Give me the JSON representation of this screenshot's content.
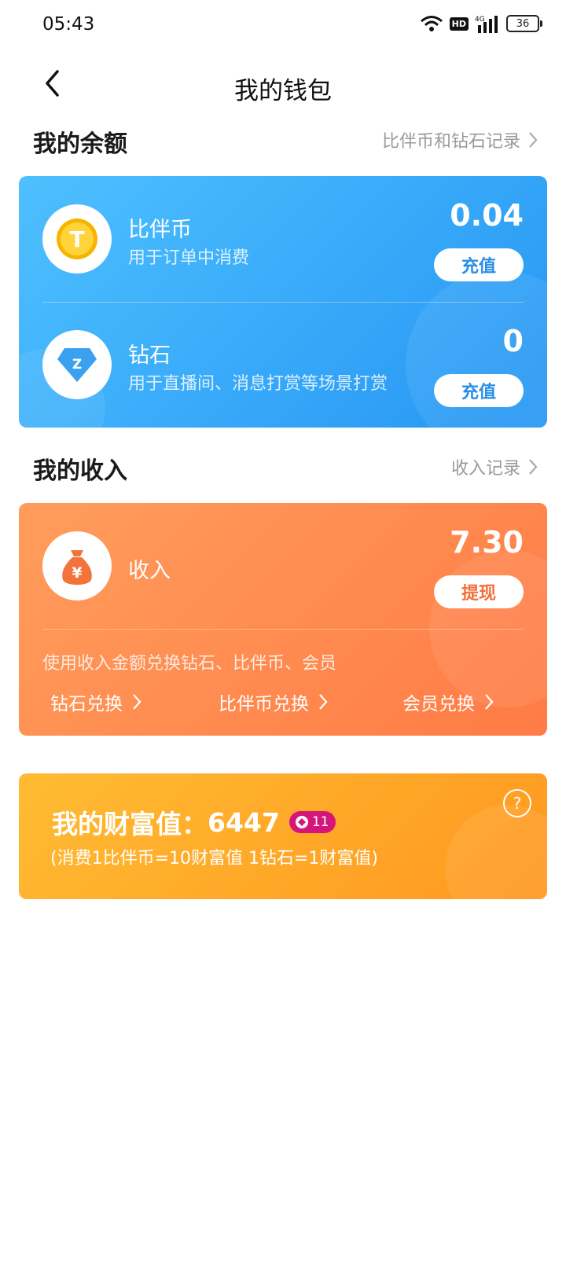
{
  "status_bar": {
    "time": "05:43",
    "hd_label": "HD",
    "signal_label": "4G",
    "battery": "36"
  },
  "nav": {
    "title": "我的钱包"
  },
  "balance_section": {
    "title": "我的余额",
    "link": "比伴币和钻石记录",
    "coin": {
      "title": "比伴币",
      "subtitle": "用于订单中消费",
      "amount": "0.04",
      "button": "充值",
      "icon_letter": "T"
    },
    "diamond": {
      "title": "钻石",
      "subtitle": "用于直播间、消息打赏等场景打赏",
      "amount": "0",
      "button": "充值",
      "icon_letter": "Z"
    }
  },
  "income_section": {
    "title": "我的收入",
    "link": "收入记录",
    "income": {
      "title": "收入",
      "amount": "7.30",
      "button": "提现",
      "icon_symbol": "¥"
    },
    "note": "使用收入金额兑换钻石、比伴币、会员",
    "exchanges": [
      "钻石兑换",
      "比伴币兑换",
      "会员兑换"
    ]
  },
  "wealth": {
    "label": "我的财富值：",
    "value": "6447",
    "level": "11",
    "formula": "(消费1比伴币=10财富值 1钻石=1财富值)",
    "help": "?"
  },
  "colors": {
    "blue_text": "#2a8fe6",
    "orange_text": "#f0713a"
  }
}
